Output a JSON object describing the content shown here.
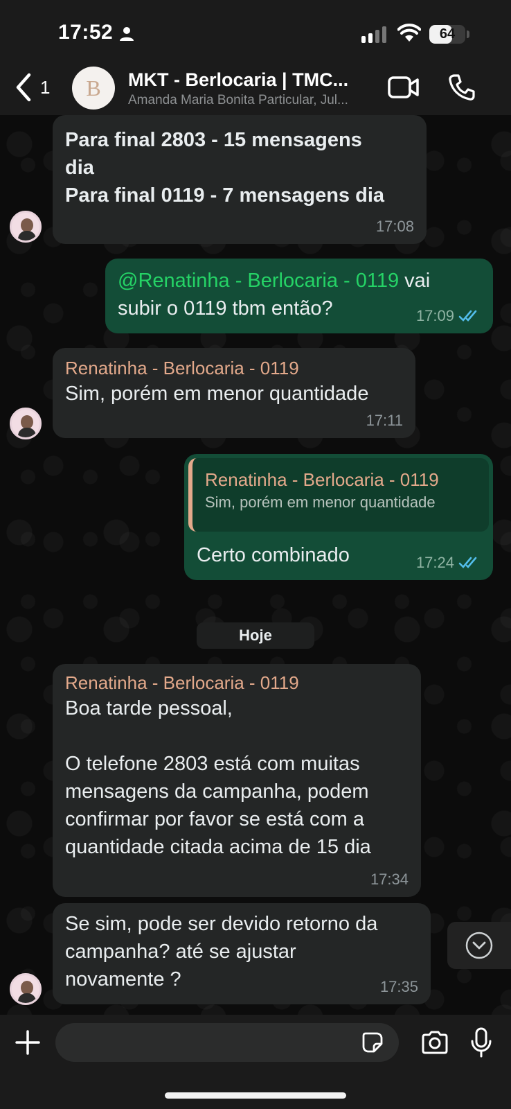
{
  "status_bar": {
    "time": "17:52",
    "battery": "64",
    "battery_level": 0.64,
    "person_icon": "person-icon",
    "signal_icon": "signal-bars-icon",
    "wifi_icon": "wifi-icon"
  },
  "header": {
    "back_count": "1",
    "avatar_letter": "B",
    "title": "MKT - Berlocaria | TMC...",
    "subtitle": "Amanda Maria Bonita Particular, Jul..."
  },
  "messages": [
    {
      "direction": "in",
      "text_lines": [
        "Para final 2803 - 15 mensagens",
        "dia",
        "Para final 0119 - 7 mensagens dia"
      ],
      "time": "17:08"
    },
    {
      "direction": "out",
      "mention": "@Renatinha - Berlocaria - 0119",
      "text_after_mention": " vai",
      "text_line2": "subir o 0119 tbm então?",
      "time": "17:09"
    },
    {
      "direction": "in",
      "sender": "Renatinha - Berlocaria - 0119",
      "text": "Sim, porém em menor quantidade",
      "time": "17:11"
    },
    {
      "direction": "out",
      "quote_sender": "Renatinha - Berlocaria - 0119",
      "quote_text": "Sim, porém em menor quantidade",
      "text": "Certo combinado",
      "time": "17:24"
    },
    {
      "direction": "in",
      "sender": "Renatinha - Berlocaria - 0119",
      "text_lines": [
        "Boa tarde pessoal,",
        "",
        "O telefone 2803 está com muitas",
        "mensagens da campanha, podem",
        "confirmar por favor se está com a",
        "quantidade citada acima de 15 dia"
      ],
      "time": "17:34"
    },
    {
      "direction": "in",
      "text_lines": [
        "Se sim, pode ser devido retorno da",
        "campanha? até se ajustar",
        "novamente ?"
      ],
      "time": "17:35"
    }
  ],
  "day_divider": "Hoje",
  "input": {
    "placeholder": ""
  },
  "colors": {
    "outgoing_bubble": "#134d37",
    "incoming_bubble": "#242626",
    "mention": "#25d366",
    "sender_name": "#e3a98b",
    "read_ticks": "#53bdeb"
  }
}
